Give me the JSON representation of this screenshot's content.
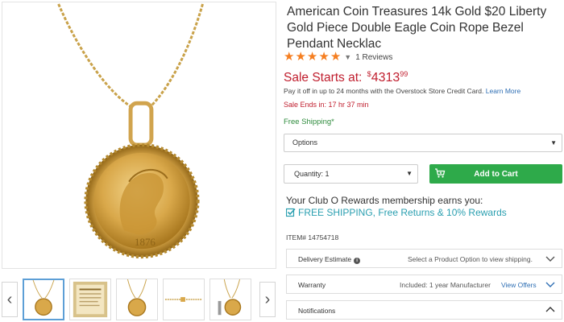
{
  "product": {
    "title": "American Coin Treasures 14k Gold $20 Liberty Gold Piece Double Eagle Coin Rope Bezel Pendant Necklac",
    "rating": 5,
    "reviews_label": "1 Reviews",
    "sale_label": "Sale Starts at:",
    "currency": "$",
    "price_dollars": "4313",
    "price_cents": "99",
    "payoff_text": "Pay it off in up to 24 months with the Overstock Store Credit Card.",
    "learn_more": "Learn More",
    "sale_ends": "Sale Ends in: 17 hr 37 min",
    "free_shipping": "Free Shipping*",
    "item_number": "ITEM# 14754718"
  },
  "controls": {
    "options_label": "Options",
    "quantity_label": "Quantity: 1",
    "add_to_cart": "Add to Cart"
  },
  "rewards": {
    "text": "Your Club O Rewards membership earns you:",
    "offer": "FREE SHIPPING, Free Returns & 10% Rewards"
  },
  "accordions": {
    "delivery": {
      "label": "Delivery Estimate",
      "meta": "Select a Product Option to view shipping."
    },
    "warranty": {
      "label": "Warranty",
      "meta": "Included: 1 year Manufacturer",
      "link": "View Offers"
    },
    "notifications": {
      "label": "Notifications"
    }
  },
  "colors": {
    "sale_red": "#c01e2e",
    "cart_green": "#2eaa4a",
    "shipping_green": "#2e8b3c",
    "star_orange": "#f57e20",
    "link_blue": "#2f6fb4",
    "club_teal": "#2a9fb0"
  },
  "icons": {
    "prev": "chevron-left-icon",
    "next": "chevron-right-icon",
    "cart": "cart-icon",
    "check": "checkbox-icon",
    "info": "info-icon",
    "expand": "chevron-down-icon",
    "collapse": "chevron-up-icon"
  }
}
